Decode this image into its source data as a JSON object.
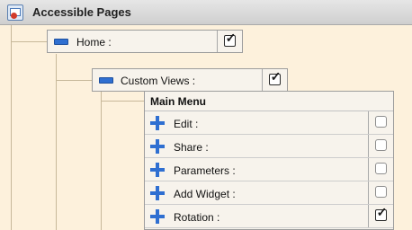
{
  "window": {
    "title": "Accessible Pages",
    "icon": "window-app-icon"
  },
  "tree": {
    "home": {
      "label": "Home :",
      "checked": true,
      "icon": "blue-bar-icon"
    },
    "custom_views": {
      "label": "Custom Views :",
      "checked": true,
      "icon": "blue-bar-icon"
    },
    "main_menu": {
      "header": "Main Menu",
      "items": [
        {
          "label": "Edit :",
          "checked": false,
          "icon": "plus-icon"
        },
        {
          "label": "Share :",
          "checked": false,
          "icon": "plus-icon"
        },
        {
          "label": "Parameters :",
          "checked": false,
          "icon": "plus-icon"
        },
        {
          "label": "Add Widget :",
          "checked": false,
          "icon": "plus-icon"
        },
        {
          "label": "Rotation :",
          "checked": true,
          "icon": "plus-icon"
        }
      ]
    }
  },
  "colors": {
    "background": "#fdf1dc",
    "accent": "#2f6fd1",
    "node_bg": "#f7f3ec"
  }
}
